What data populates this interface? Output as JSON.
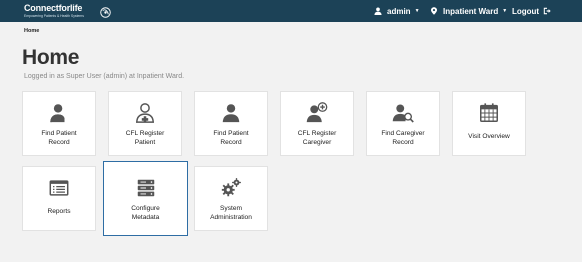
{
  "header": {
    "brand_name": "Connectforlife",
    "brand_tagline": "Empowering Patients & Health Systems",
    "user_label": "admin",
    "location_label": "Inpatient Ward",
    "logout_label": "Logout"
  },
  "breadcrumb": "Home",
  "page": {
    "title": "Home",
    "subtitle": "Logged in as Super User (admin) at Inpatient Ward."
  },
  "tiles": [
    {
      "label": "Find Patient\nRecord",
      "icon": "user-search-icon"
    },
    {
      "label": "CFL Register\nPatient",
      "icon": "user-medical-icon"
    },
    {
      "label": "Find Patient\nRecord",
      "icon": "user-icon"
    },
    {
      "label": "CFL Register\nCaregiver",
      "icon": "user-add-icon"
    },
    {
      "label": "Find Caregiver\nRecord",
      "icon": "user-magnify-icon"
    },
    {
      "label": "Visit Overview",
      "icon": "calendar-icon"
    },
    {
      "label": "Reports",
      "icon": "list-icon"
    },
    {
      "label": "Configure\nMetadata",
      "icon": "server-icon"
    },
    {
      "label": "System\nAdministration",
      "icon": "gears-icon"
    }
  ],
  "colors": {
    "topbar": "#1c4257",
    "icon": "#555555",
    "selected_border": "#2e6da4"
  }
}
